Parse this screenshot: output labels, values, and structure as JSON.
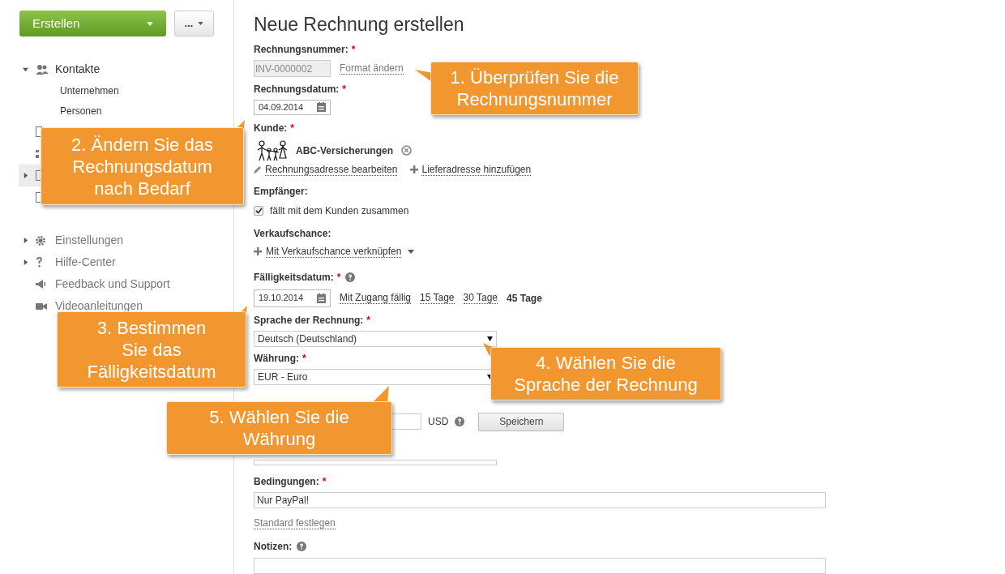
{
  "sidebar": {
    "create_button": "Erstellen",
    "more_button": "...",
    "items": [
      {
        "label": "Kontakte",
        "kind": "people",
        "expanded": true,
        "selected": false,
        "children": [
          {
            "label": "Unternehmen"
          },
          {
            "label": "Personen"
          }
        ]
      },
      {
        "kind": "document",
        "selected": false
      },
      {
        "kind": "list",
        "selected": false
      },
      {
        "kind": "document",
        "expanded": false,
        "selected": true
      },
      {
        "kind": "document",
        "selected": false
      },
      {
        "label": "Einstellungen",
        "kind": "gear",
        "expanded": false,
        "selected": false
      },
      {
        "label": "Hilfe-Center",
        "kind": "question",
        "expanded": false,
        "selected": false
      },
      {
        "label": "Feedback und Support",
        "kind": "megaphone",
        "selected": false
      },
      {
        "label": "Videoanleitungen",
        "kind": "camera",
        "selected": false
      }
    ]
  },
  "form": {
    "title": "Neue Rechnung erstellen",
    "invoice_number": {
      "label": "Rechnungsnummer:",
      "required": "*",
      "value": "INV-0000002",
      "link": "Format ändern"
    },
    "invoice_date": {
      "label": "Rechnungsdatum:",
      "required": "*",
      "value": "04.09.2014"
    },
    "customer": {
      "label": "Kunde:",
      "required": "*",
      "name": "ABC-Versicherungen",
      "edit_link": "Rechnungsadresse bearbeiten",
      "add_link": "Lieferadresse hinzufügen"
    },
    "recipient": {
      "label": "Empfänger:",
      "checkbox_label": "fällt mit dem Kunden zusammen",
      "checked": true
    },
    "opportunity": {
      "label": "Verkaufschance:",
      "link": "Mit Verkaufschance verknüpfen"
    },
    "due_date": {
      "label": "Fälligkeitsdatum:",
      "required": "*",
      "value": "19.10.2014",
      "options": [
        {
          "label": "Mit Zugang fällig",
          "selected": false
        },
        {
          "label": "15 Tage",
          "selected": false
        },
        {
          "label": "30 Tage",
          "selected": false
        },
        {
          "label": "45 Tage",
          "selected": true
        }
      ]
    },
    "language": {
      "label": "Sprache der Rechnung:",
      "required": "*",
      "value": "Deutsch (Deutschland)"
    },
    "currency": {
      "label": "Währung:",
      "required": "*",
      "value": "EUR - Euro"
    },
    "rate": {
      "unit": "USD",
      "button": "Speichern"
    },
    "terms": {
      "label": "Bedingungen:",
      "required": "*",
      "value": "Nur PayPal!",
      "link": "Standard festlegen"
    },
    "notes": {
      "label": "Notizen:"
    }
  },
  "callouts": [
    {
      "text": "1. Überprüfen Sie die Rechnungsnummer"
    },
    {
      "text": "2. Ändern Sie das Rechnungsdatum nach Bedarf"
    },
    {
      "text": "3. Bestimmen Sie das Fälligkeitsdatum"
    },
    {
      "text": "4. Wählen Sie die Sprache der Rechnung"
    },
    {
      "text": "5. Wählen Sie die Währung"
    }
  ]
}
